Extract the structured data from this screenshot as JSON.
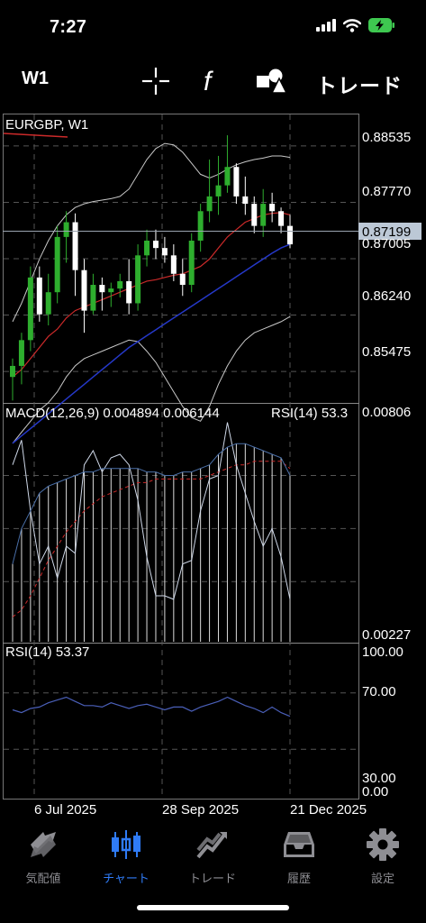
{
  "status_bar": {
    "time": "7:27"
  },
  "toolbar": {
    "timeframe": "W1",
    "trade_label": "トレード"
  },
  "chart": {
    "symbol_label": "EURGBP, W1",
    "price_ticks": [
      "0.88535",
      "0.87770",
      "0.87005",
      "0.86240",
      "0.85475"
    ],
    "current_price": "0.87199",
    "macd_label": "MACD(12,26,9) 0.004894 0.006144",
    "macd_top": "0.00806",
    "macd_bottom": "0.00227",
    "rsi_overlap_label": "RSI(14) 53.3",
    "rsi_label": "RSI(14) 53.37",
    "rsi_ticks": [
      "100.00",
      "70.00",
      "30.00",
      "0.00"
    ],
    "date_labels": [
      "6 Jul 2025",
      "28 Sep 2025",
      "21 Dec 2025"
    ],
    "colors": {
      "bull": "#2eae2e",
      "bear": "#ffffff",
      "ma_red": "#cc2a2a",
      "ma_blue": "#2538c8",
      "bands": "#c8c8c8",
      "grid": "#555555",
      "price_tag": "#bcc8d6"
    }
  },
  "chart_data": [
    {
      "type": "candlestick",
      "title": "EURGBP, W1",
      "ylim": [
        0.8506,
        0.8895
      ],
      "y_ticks": [
        0.88535,
        0.8777,
        0.87005,
        0.8624,
        0.85475
      ],
      "current_price": 0.87199,
      "candles": [
        {
          "o": 0.854,
          "h": 0.8565,
          "l": 0.8508,
          "c": 0.8555
        },
        {
          "o": 0.8555,
          "h": 0.86,
          "l": 0.853,
          "c": 0.859
        },
        {
          "o": 0.859,
          "h": 0.869,
          "l": 0.8575,
          "c": 0.8675
        },
        {
          "o": 0.8675,
          "h": 0.869,
          "l": 0.8615,
          "c": 0.8625
        },
        {
          "o": 0.8625,
          "h": 0.868,
          "l": 0.861,
          "c": 0.8655
        },
        {
          "o": 0.8655,
          "h": 0.8745,
          "l": 0.864,
          "c": 0.873
        },
        {
          "o": 0.873,
          "h": 0.8765,
          "l": 0.8695,
          "c": 0.875
        },
        {
          "o": 0.875,
          "h": 0.8762,
          "l": 0.865,
          "c": 0.8685
        },
        {
          "o": 0.8685,
          "h": 0.87,
          "l": 0.86,
          "c": 0.863
        },
        {
          "o": 0.863,
          "h": 0.868,
          "l": 0.8625,
          "c": 0.8665
        },
        {
          "o": 0.8665,
          "h": 0.8675,
          "l": 0.863,
          "c": 0.8655
        },
        {
          "o": 0.8655,
          "h": 0.8668,
          "l": 0.8635,
          "c": 0.866
        },
        {
          "o": 0.866,
          "h": 0.868,
          "l": 0.8648,
          "c": 0.867
        },
        {
          "o": 0.867,
          "h": 0.87,
          "l": 0.8625,
          "c": 0.864
        },
        {
          "o": 0.864,
          "h": 0.872,
          "l": 0.863,
          "c": 0.8705
        },
        {
          "o": 0.8705,
          "h": 0.874,
          "l": 0.869,
          "c": 0.8725
        },
        {
          "o": 0.8725,
          "h": 0.874,
          "l": 0.87,
          "c": 0.8715
        },
        {
          "o": 0.8715,
          "h": 0.873,
          "l": 0.8695,
          "c": 0.8705
        },
        {
          "o": 0.8705,
          "h": 0.872,
          "l": 0.867,
          "c": 0.868
        },
        {
          "o": 0.868,
          "h": 0.87,
          "l": 0.865,
          "c": 0.8665
        },
        {
          "o": 0.8665,
          "h": 0.8735,
          "l": 0.8655,
          "c": 0.8725
        },
        {
          "o": 0.8725,
          "h": 0.8775,
          "l": 0.871,
          "c": 0.8765
        },
        {
          "o": 0.8765,
          "h": 0.8835,
          "l": 0.875,
          "c": 0.8785
        },
        {
          "o": 0.8785,
          "h": 0.884,
          "l": 0.876,
          "c": 0.88
        },
        {
          "o": 0.88,
          "h": 0.8868,
          "l": 0.879,
          "c": 0.8825
        },
        {
          "o": 0.8825,
          "h": 0.883,
          "l": 0.8775,
          "c": 0.8785
        },
        {
          "o": 0.8785,
          "h": 0.8812,
          "l": 0.876,
          "c": 0.8775
        },
        {
          "o": 0.8775,
          "h": 0.8785,
          "l": 0.8735,
          "c": 0.8745
        },
        {
          "o": 0.8745,
          "h": 0.8795,
          "l": 0.873,
          "c": 0.8775
        },
        {
          "o": 0.8775,
          "h": 0.879,
          "l": 0.875,
          "c": 0.8765
        },
        {
          "o": 0.8765,
          "h": 0.877,
          "l": 0.8735,
          "c": 0.8745
        },
        {
          "o": 0.8745,
          "h": 0.876,
          "l": 0.8715,
          "c": 0.872
        }
      ],
      "ma_red": [
        0.854,
        0.855,
        0.8565,
        0.858,
        0.8595,
        0.8605,
        0.862,
        0.863,
        0.8635,
        0.864,
        0.8645,
        0.865,
        0.8655,
        0.866,
        0.8665,
        0.867,
        0.8672,
        0.8675,
        0.8678,
        0.868,
        0.8685,
        0.869,
        0.87,
        0.8715,
        0.873,
        0.874,
        0.875,
        0.8755,
        0.876,
        0.8762,
        0.8763,
        0.876
      ],
      "ma_blue": [
        0.845,
        0.846,
        0.847,
        0.848,
        0.849,
        0.85,
        0.851,
        0.852,
        0.853,
        0.854,
        0.855,
        0.856,
        0.857,
        0.858,
        0.8588,
        0.8596,
        0.8604,
        0.8612,
        0.862,
        0.8628,
        0.8636,
        0.8644,
        0.8652,
        0.866,
        0.8668,
        0.8676,
        0.8684,
        0.8692,
        0.87,
        0.8708,
        0.8715,
        0.872
      ],
      "band_upper": [
        0.8615,
        0.864,
        0.867,
        0.87,
        0.8725,
        0.8745,
        0.876,
        0.877,
        0.8775,
        0.8778,
        0.878,
        0.8782,
        0.8785,
        0.8795,
        0.8815,
        0.8835,
        0.885,
        0.8857,
        0.8855,
        0.8845,
        0.883,
        0.8815,
        0.881,
        0.8815,
        0.8822,
        0.8828,
        0.8832,
        0.8835,
        0.8837,
        0.884,
        0.884,
        0.8838
      ],
      "band_lower": [
        0.845,
        0.8465,
        0.848,
        0.8495,
        0.8505,
        0.852,
        0.854,
        0.8555,
        0.8565,
        0.857,
        0.8575,
        0.858,
        0.8585,
        0.859,
        0.8588,
        0.8575,
        0.856,
        0.854,
        0.852,
        0.85,
        0.8485,
        0.848,
        0.85,
        0.853,
        0.8555,
        0.8575,
        0.859,
        0.86,
        0.8605,
        0.861,
        0.8615,
        0.8622
      ]
    },
    {
      "type": "bar",
      "title": "MACD(12,26,9) 0.004894 0.006144",
      "ylim": [
        0.0018,
        0.0085
      ],
      "y_ticks": [
        0.00806,
        0.00227
      ],
      "macd": [
        0.004,
        0.005,
        0.0055,
        0.006,
        0.0062,
        0.0063,
        0.0064,
        0.0065,
        0.0066,
        0.0066,
        0.0067,
        0.0067,
        0.0067,
        0.0067,
        0.0067,
        0.0066,
        0.0066,
        0.0065,
        0.0065,
        0.0066,
        0.0066,
        0.0067,
        0.0068,
        0.0071,
        0.0073,
        0.0074,
        0.0074,
        0.0073,
        0.0072,
        0.0071,
        0.007,
        0.0065
      ],
      "signal": [
        0.0025,
        0.0027,
        0.0031,
        0.0036,
        0.0041,
        0.0045,
        0.0049,
        0.0052,
        0.0055,
        0.0057,
        0.0059,
        0.006,
        0.0061,
        0.0062,
        0.0063,
        0.0063,
        0.0064,
        0.0064,
        0.0064,
        0.0064,
        0.0064,
        0.0064,
        0.0065,
        0.0066,
        0.0067,
        0.0068,
        0.0068,
        0.0069,
        0.0069,
        0.0069,
        0.0069,
        0.0067
      ],
      "white_line": [
        0.0068,
        0.0075,
        0.0055,
        0.004,
        0.0045,
        0.0036,
        0.0045,
        0.0043,
        0.0068,
        0.0072,
        0.0066,
        0.007,
        0.0071,
        0.0068,
        0.0058,
        0.0042,
        0.0031,
        0.0031,
        0.003,
        0.004,
        0.0041,
        0.0055,
        0.0064,
        0.0065,
        0.008,
        0.0068,
        0.006,
        0.0052,
        0.0045,
        0.005,
        0.0042,
        0.003
      ]
    },
    {
      "type": "line",
      "title": "RSI(14) 53.37",
      "ylim": [
        0,
        100
      ],
      "y_ticks": [
        100,
        70,
        30,
        0
      ],
      "rsi": [
        58,
        56,
        59,
        60,
        63,
        65,
        67,
        64,
        61,
        61,
        60,
        63,
        61,
        59,
        61,
        62,
        60,
        58,
        60,
        60,
        57,
        60,
        62,
        64,
        67,
        64,
        61,
        59,
        56,
        60,
        56,
        53.37
      ]
    }
  ],
  "tabbar": {
    "tabs": [
      {
        "label": "気配値",
        "icon": "quotes-icon"
      },
      {
        "label": "チャート",
        "icon": "chart-icon"
      },
      {
        "label": "トレード",
        "icon": "trade-icon"
      },
      {
        "label": "履歴",
        "icon": "history-icon"
      },
      {
        "label": "設定",
        "icon": "settings-icon"
      }
    ],
    "active_index": 1,
    "active_color": "#2f7bf6",
    "inactive_color": "#8e8e93"
  }
}
